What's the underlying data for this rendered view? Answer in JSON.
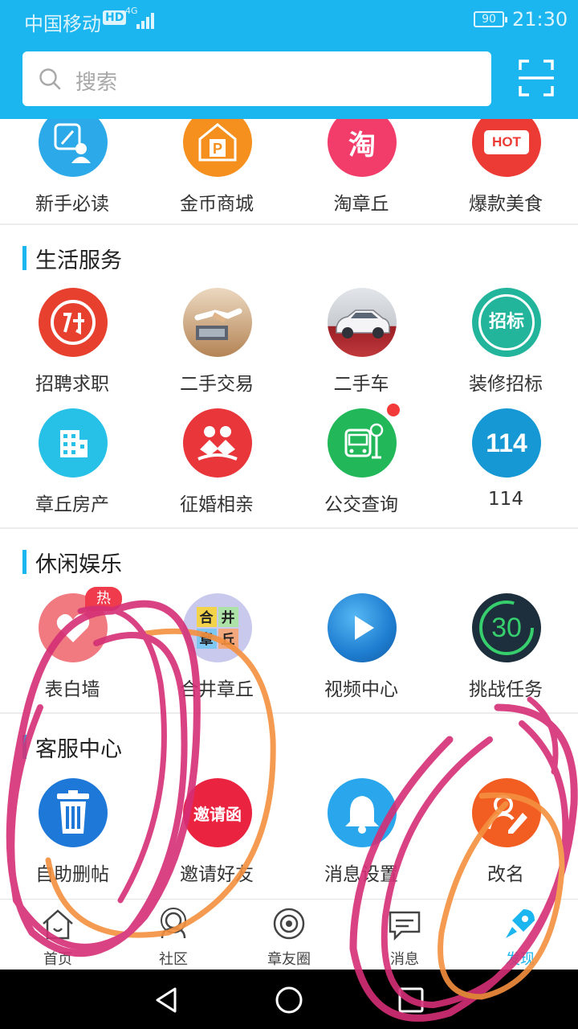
{
  "status_bar": {
    "carrier": "中国移动",
    "hd": "HD",
    "network": "4G",
    "battery": "90",
    "time": "21:30"
  },
  "search": {
    "placeholder": "搜索",
    "icon": "search-icon",
    "scan_icon": "scan-icon"
  },
  "top_row": [
    {
      "label": "新手必读",
      "icon": "guide-icon",
      "color": "#2ca9e8"
    },
    {
      "label": "金币商城",
      "icon": "parking-mall-icon",
      "color": "#f5901e"
    },
    {
      "label": "淘章丘",
      "icon": "taobao-icon",
      "color": "#f23c6a",
      "glyph": "淘"
    },
    {
      "label": "爆款美食",
      "icon": "hot-food-icon",
      "color": "#ec3a35",
      "glyph": "HOT"
    }
  ],
  "sections": [
    {
      "title": "生活服务",
      "rows": [
        [
          {
            "label": "招聘求职",
            "icon": "recruit-icon",
            "color": "#e8402e"
          },
          {
            "label": "二手交易",
            "icon": "handshake-icon",
            "color": "#d8a672"
          },
          {
            "label": "二手车",
            "icon": "used-car-icon",
            "color": "#b2242a"
          },
          {
            "label": "装修招标",
            "icon": "bidding-icon",
            "color": "#23b49c",
            "glyph": "招标"
          }
        ],
        [
          {
            "label": "章丘房产",
            "icon": "building-icon",
            "color": "#27c0e6"
          },
          {
            "label": "征婚相亲",
            "icon": "dating-icon",
            "color": "#e8363a"
          },
          {
            "label": "公交查询",
            "icon": "bus-icon",
            "color": "#22b85a",
            "dot": true
          },
          {
            "label": "114",
            "icon": "phone-114-icon",
            "color": "#1598d3",
            "glyph": "114"
          }
        ]
      ]
    },
    {
      "title": "休闲娱乐",
      "rows": [
        [
          {
            "label": "表白墙",
            "icon": "confession-wall-icon",
            "color": "#f07a80",
            "badge": "热"
          },
          {
            "label": "合井章丘",
            "icon": "merge-game-icon",
            "color": "#c9c9ee"
          },
          {
            "label": "视频中心",
            "icon": "play-video-icon",
            "color": "#1e7dd0"
          },
          {
            "label": "挑战任务",
            "icon": "challenge-timer-icon",
            "color": "#1d2f3c",
            "glyph": "30"
          }
        ]
      ]
    },
    {
      "title": "客服中心",
      "rows": [
        [
          {
            "label": "自助删帖",
            "icon": "trash-icon",
            "color": "#1e78d8"
          },
          {
            "label": "邀请好友",
            "icon": "invite-icon",
            "color": "#ea2440",
            "glyph": "邀请函"
          },
          {
            "label": "消息设置",
            "icon": "bell-icon",
            "color": "#2aa7ec"
          },
          {
            "label": "改名",
            "icon": "rename-icon",
            "color": "#f25d22"
          }
        ]
      ]
    }
  ],
  "bottom_nav": [
    {
      "label": "首页",
      "icon": "home-icon"
    },
    {
      "label": "社区",
      "icon": "community-icon"
    },
    {
      "label": "章友圈",
      "icon": "friends-circle-icon"
    },
    {
      "label": "消息",
      "icon": "message-icon"
    },
    {
      "label": "发现",
      "icon": "discover-rocket-icon",
      "active": true
    }
  ],
  "colors": {
    "accent": "#1bb5f0",
    "scribble_magenta": "#d52f76",
    "scribble_orange": "#f5903f"
  }
}
